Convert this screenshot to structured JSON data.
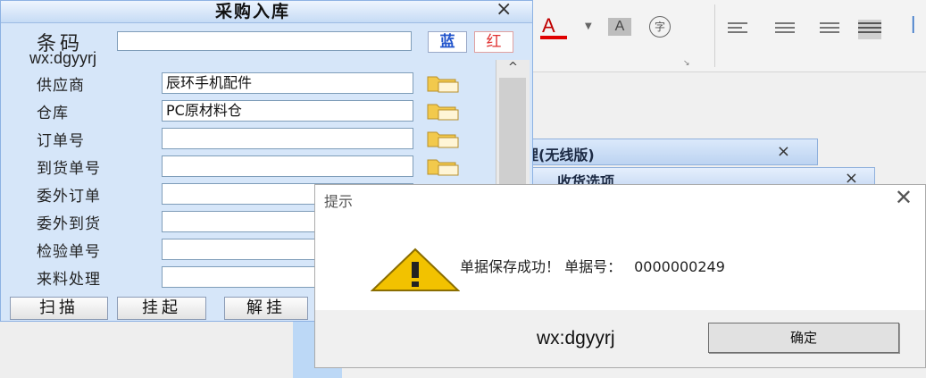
{
  "ribbon": {
    "font_color_glyph": "A",
    "shade_glyph": "A",
    "phonetic_glyph": "字",
    "accent_red": "#e00000"
  },
  "background_windows": {
    "window1_title": "理(无线版)",
    "window2_title": "收货选项",
    "close_glyph": "×"
  },
  "purchase_dialog": {
    "title": "采购入库",
    "close_glyph": "×",
    "barcode_label": "条码",
    "barcode_value": "",
    "blue_button": "蓝",
    "red_button": "红",
    "watermark": "wx:dgyyrj",
    "fields": [
      {
        "label": "供应商",
        "value": "辰环手机配件",
        "has_picker": true
      },
      {
        "label": "仓库",
        "value": "PC原材料仓",
        "has_picker": true
      },
      {
        "label": "订单号",
        "value": "",
        "has_picker": true
      },
      {
        "label": "到货单号",
        "value": "",
        "has_picker": true
      },
      {
        "label": "委外订单",
        "value": "",
        "has_picker": false
      },
      {
        "label": "委外到货",
        "value": "",
        "has_picker": false
      },
      {
        "label": "检验单号",
        "value": "",
        "has_picker": false
      },
      {
        "label": "来料处理",
        "value": "",
        "has_picker": false
      }
    ],
    "buttons": {
      "scan": "扫描",
      "hold": "挂起",
      "unhold": "解挂"
    },
    "scroll_up_glyph": "^"
  },
  "prompt_dialog": {
    "title": "提示",
    "close_glyph": "✕",
    "message": "单据保存成功！ 单据号：",
    "doc_number": "0000000249",
    "watermark": "wx:dgyyrj",
    "ok_button": "确定",
    "warning_color": "#f2c200"
  }
}
